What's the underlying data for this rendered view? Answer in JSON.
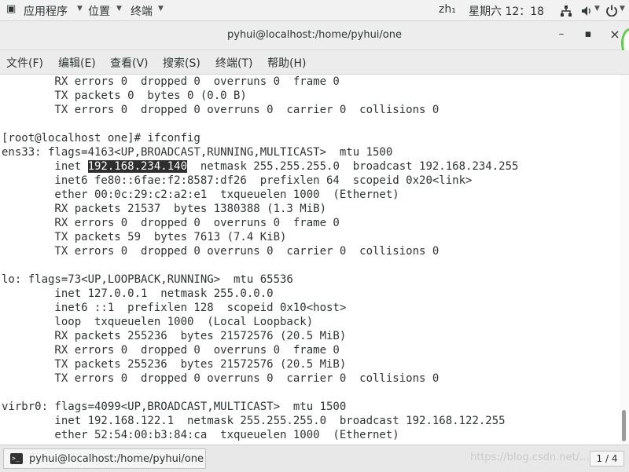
{
  "topbar": {
    "applications": "应用程序",
    "places": "位置",
    "terminal": "终端",
    "input_method": "zh₁",
    "clock": "星期六 12：18"
  },
  "window": {
    "title": "pyhui@localhost:/home/pyhui/one",
    "minimize": "–",
    "maximize": "▪",
    "close": "×"
  },
  "menubar": [
    "文件(F)",
    "编辑(E)",
    "查看(V)",
    "搜索(S)",
    "终端(T)",
    "帮助(H)"
  ],
  "terminal": {
    "lines": [
      "        RX errors 0  dropped 0  overruns 0  frame 0",
      "        TX packets 0  bytes 0 (0.0 B)",
      "        TX errors 0  dropped 0 overruns 0  carrier 0  collisions 0",
      "",
      "[root@localhost one]# ifconfig",
      "ens33: flags=4163<UP,BROADCAST,RUNNING,MULTICAST>  mtu 1500",
      "        inet 192.168.234.140  netmask 255.255.255.0  broadcast 192.168.234.255",
      "        inet6 fe80::6fae:f2:8587:df26  prefixlen 64  scopeid 0x20<link>",
      "        ether 00:0c:29:c2:a2:e1  txqueuelen 1000  (Ethernet)",
      "        RX packets 21537  bytes 1380388 (1.3 MiB)",
      "        RX errors 0  dropped 0  overruns 0  frame 0",
      "        TX packets 59  bytes 7613 (7.4 KiB)",
      "        TX errors 0  dropped 0 overruns 0  carrier 0  collisions 0",
      "",
      "lo: flags=73<UP,LOOPBACK,RUNNING>  mtu 65536",
      "        inet 127.0.0.1  netmask 255.0.0.0",
      "        inet6 ::1  prefixlen 128  scopeid 0x10<host>",
      "        loop  txqueuelen 1000  (Local Loopback)",
      "        RX packets 255236  bytes 21572576 (20.5 MiB)",
      "        RX errors 0  dropped 0  overruns 0  frame 0",
      "        TX packets 255236  bytes 21572576 (20.5 MiB)",
      "        TX errors 0  dropped 0 overruns 0  carrier 0  collisions 0",
      "",
      "virbr0: flags=4099<UP,BROADCAST,MULTICAST>  mtu 1500",
      "        inet 192.168.122.1  netmask 255.255.255.0  broadcast 192.168.122.255",
      "        ether 52:54:00:b3:84:ca  txqueuelen 1000  (Ethernet)"
    ],
    "selection": {
      "line": 6,
      "text": "192.168.234.140"
    }
  },
  "taskbar": {
    "window_label": "pyhui@localhost:/home/pyhui/one",
    "watermark": "https://blog.csdn.net/...",
    "pager": "1 / 4"
  },
  "colors": {
    "terminal_bg": "#ffffff",
    "terminal_fg": "#2e3436",
    "selection_bg": "#2e2e2e",
    "notification_ring": "#5ccc4a"
  }
}
